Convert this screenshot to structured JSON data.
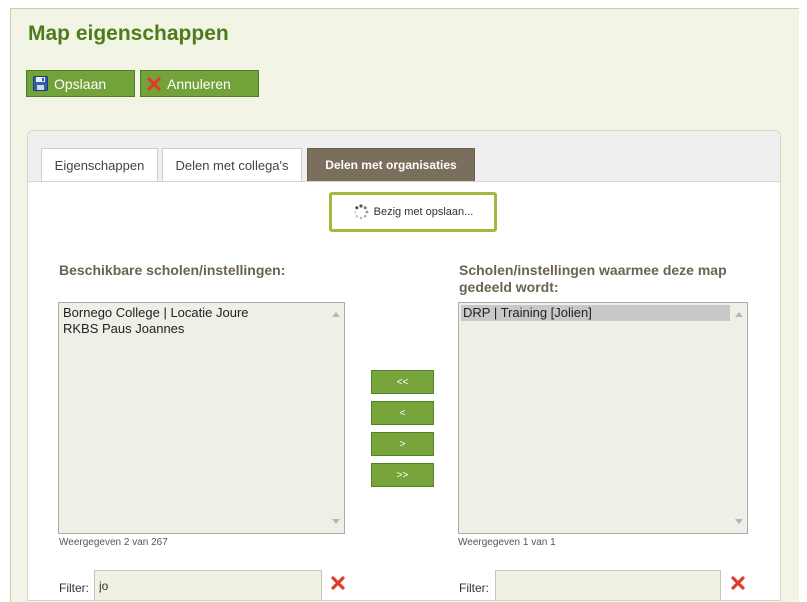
{
  "page": {
    "title": "Map eigenschappen"
  },
  "toolbar": {
    "save_label": "Opslaan",
    "cancel_label": "Annuleren"
  },
  "tabs": [
    {
      "label": "Eigenschappen",
      "active": false
    },
    {
      "label": "Delen met collega's",
      "active": false
    },
    {
      "label": "Delen met organisaties",
      "active": true
    }
  ],
  "status": {
    "saving_text": "Bezig met opslaan..."
  },
  "available": {
    "label": "Beschikbare scholen/instellingen:",
    "items": [
      "Bornego College | Locatie Joure",
      "RKBS Paus Joannes"
    ],
    "count_text": "Weergegeven 2 van 267",
    "filter_label": "Filter:",
    "filter_value": "jo"
  },
  "shared": {
    "label": "Scholen/instellingen waarmee deze map gedeeld wordt:",
    "items": [
      "DRP | Training [Jolien]"
    ],
    "selected_index": 0,
    "count_text": "Weergegeven 1 van 1",
    "filter_label": "Filter:",
    "filter_value": ""
  },
  "move_buttons": {
    "all_left": "<<",
    "left": "<",
    "right": ">",
    "all_right": ">>"
  },
  "icons": {
    "save": "floppy-disk-icon",
    "cancel": "red-x-icon",
    "spinner": "loading-spinner-icon",
    "clear_filter": "red-x-icon"
  },
  "colors": {
    "title": "#4d7c19",
    "button": "#73a23b",
    "active_tab": "#7a6e5c",
    "clear": "#e03a2b",
    "saving_border": "#a3b83c"
  }
}
